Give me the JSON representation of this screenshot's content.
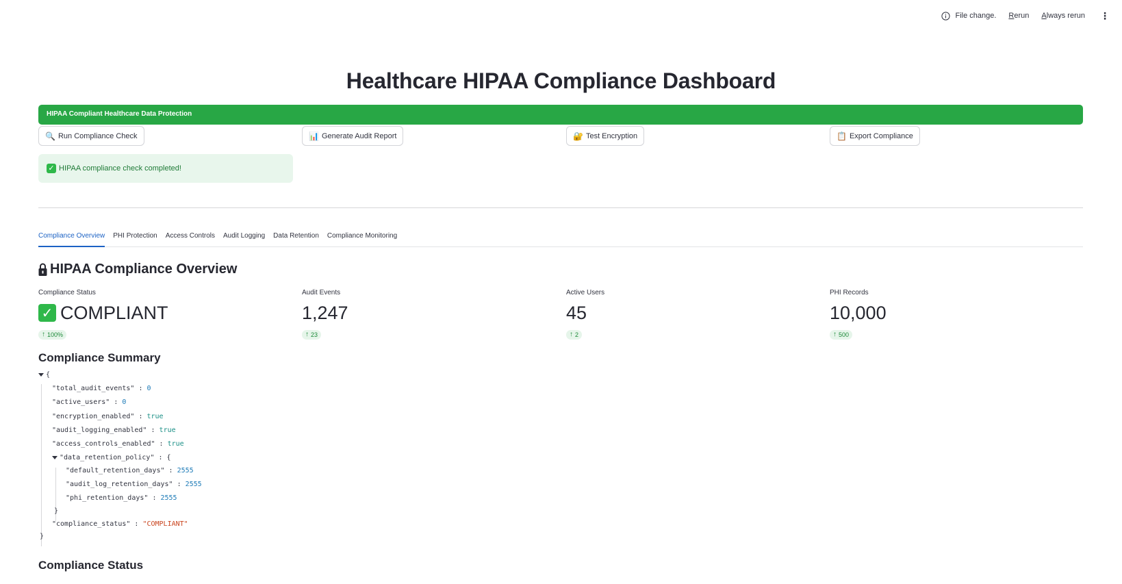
{
  "toolbar": {
    "status_text": "File change.",
    "rerun_first": "R",
    "rerun_rest": "erun",
    "always_first": "A",
    "always_rest": "lways rerun"
  },
  "page": {
    "title": "Healthcare HIPAA Compliance Dashboard",
    "banner": "HIPAA Compliant Healthcare Data Protection"
  },
  "actions": [
    {
      "icon": "🔍",
      "label": "Run Compliance Check"
    },
    {
      "icon": "📊",
      "label": "Generate Audit Report"
    },
    {
      "icon": "🔐",
      "label": "Test Encryption"
    },
    {
      "icon": "📋",
      "label": "Export Compliance"
    }
  ],
  "success": {
    "text": "HIPAA compliance check completed!"
  },
  "tabs": [
    "Compliance Overview",
    "PHI Protection",
    "Access Controls",
    "Audit Logging",
    "Data Retention",
    "Compliance Monitoring"
  ],
  "overview": {
    "title": "HIPAA Compliance Overview",
    "metrics": [
      {
        "label": "Compliance Status",
        "value": "COMPLIANT",
        "delta": "100%"
      },
      {
        "label": "Audit Events",
        "value": "1,247",
        "delta": "23"
      },
      {
        "label": "Active Users",
        "value": "45",
        "delta": "2"
      },
      {
        "label": "PHI Records",
        "value": "10,000",
        "delta": "500"
      }
    ]
  },
  "summary": {
    "title": "Compliance Summary",
    "json": {
      "open": "{",
      "close": "}",
      "total_audit_events_key": "\"total_audit_events\"",
      "total_audit_events": "0",
      "active_users_key": "\"active_users\"",
      "active_users": "0",
      "encryption_enabled_key": "\"encryption_enabled\"",
      "encryption_enabled": "true",
      "audit_logging_enabled_key": "\"audit_logging_enabled\"",
      "audit_logging_enabled": "true",
      "access_controls_enabled_key": "\"access_controls_enabled\"",
      "access_controls_enabled": "true",
      "data_retention_policy_key": "\"data_retention_policy\"",
      "default_retention_days_key": "\"default_retention_days\"",
      "default_retention_days": "2555",
      "audit_log_retention_days_key": "\"audit_log_retention_days\"",
      "audit_log_retention_days": "2555",
      "phi_retention_days_key": "\"phi_retention_days\"",
      "phi_retention_days": "2555",
      "compliance_status_key": "\"compliance_status\"",
      "compliance_status": "\"COMPLIANT\""
    }
  },
  "status_section": {
    "title": "Compliance Status"
  },
  "colors": {
    "banner": "#28a745",
    "active_tab": "#1c62c4",
    "success_bg": "#e8f6ec"
  }
}
